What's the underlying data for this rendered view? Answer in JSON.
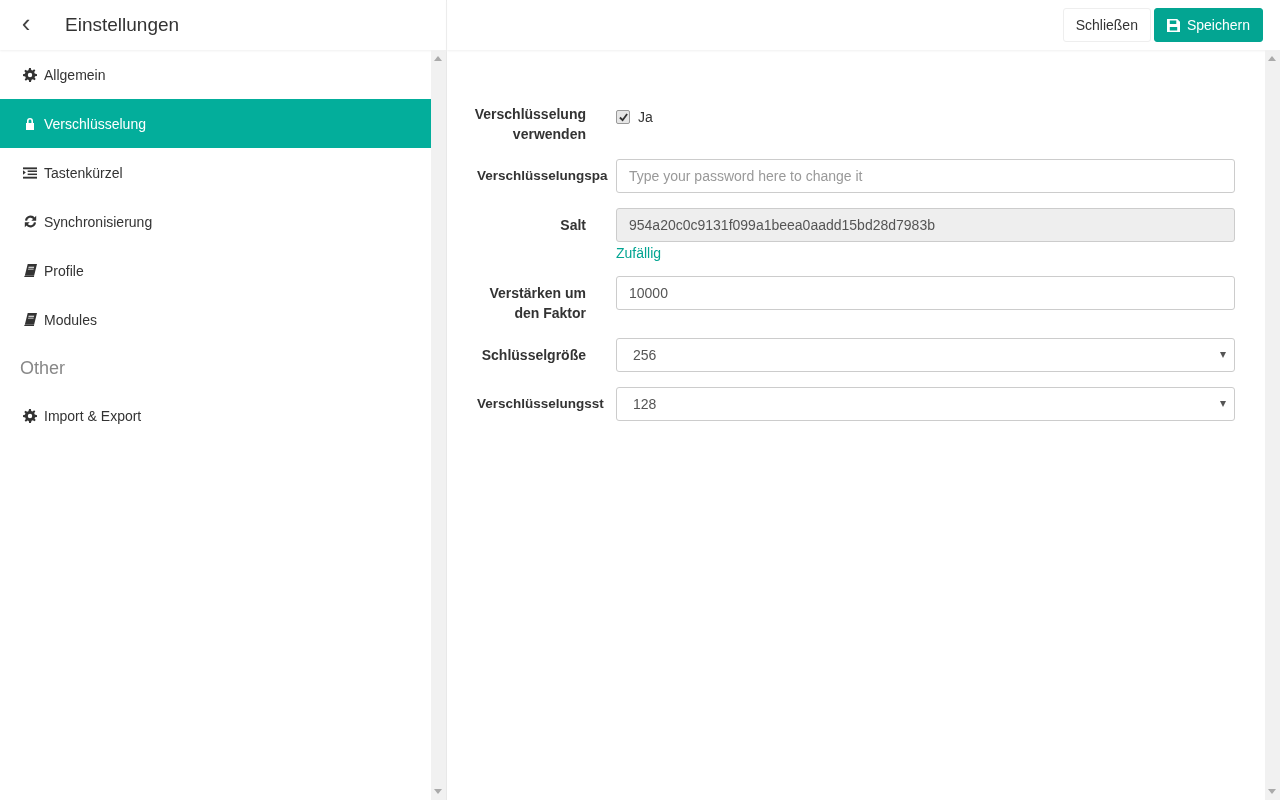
{
  "sidebar": {
    "back": "‹",
    "title": "Einstellungen",
    "items": [
      {
        "label": "Allgemein",
        "kind": "gear",
        "selected": false
      },
      {
        "label": "Verschlüsselung",
        "kind": "lock",
        "selected": true
      },
      {
        "label": "Tastenkürzel",
        "kind": "list",
        "selected": false
      },
      {
        "label": "Synchronisierung",
        "kind": "sync",
        "selected": false
      },
      {
        "label": "Profile",
        "kind": "book",
        "selected": false
      },
      {
        "label": "Modules",
        "kind": "book",
        "selected": false
      }
    ],
    "section": "Other",
    "other_items": [
      {
        "label": "Import & Export",
        "kind": "gear",
        "selected": false
      }
    ]
  },
  "toolbar": {
    "close": "Schließen",
    "save": "Speichern"
  },
  "form": [
    {
      "kind": "checkbox",
      "label": "Verschlüsselung verwenden",
      "checked": true,
      "text": "Ja"
    },
    {
      "kind": "input",
      "label": "Verschlüsselungspa",
      "placeholder": "Type your password here to change it"
    },
    {
      "kind": "input",
      "label": "Salt",
      "value": "954a20c0c9131f099a1beea0aadd15bd28d7983b",
      "disabled": true,
      "link": "Zufällig"
    },
    {
      "kind": "input",
      "label": "Verstärken um den Faktor",
      "value": "10000",
      "disabled": false
    },
    {
      "kind": "select",
      "label": "Schlüsselgröße",
      "value": "256"
    },
    {
      "kind": "select",
      "label": "Verschlüsselungsst",
      "value": "128"
    }
  ]
}
